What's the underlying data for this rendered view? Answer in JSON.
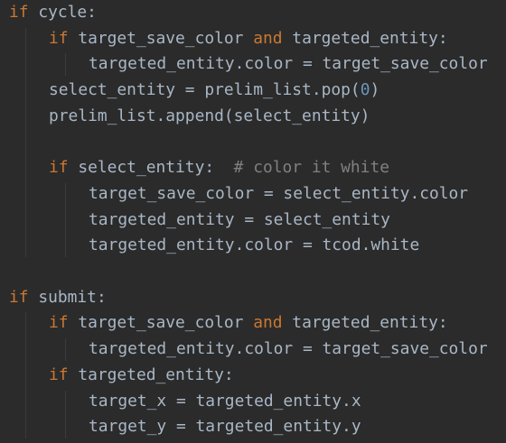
{
  "code_lines": [
    {
      "indent": 0,
      "tokens": [
        {
          "t": "kw",
          "v": "if"
        },
        {
          "t": "plain",
          "v": " cycle:"
        }
      ]
    },
    {
      "indent": 1,
      "tokens": [
        {
          "t": "kw",
          "v": "if"
        },
        {
          "t": "plain",
          "v": " target_save_color "
        },
        {
          "t": "kw",
          "v": "and"
        },
        {
          "t": "plain",
          "v": " targeted_entity:"
        }
      ]
    },
    {
      "indent": 2,
      "tokens": [
        {
          "t": "plain",
          "v": "targeted_entity.color = target_save_color"
        }
      ]
    },
    {
      "indent": 1,
      "tokens": [
        {
          "t": "plain",
          "v": "select_entity = prelim_list.pop("
        },
        {
          "t": "num",
          "v": "0"
        },
        {
          "t": "plain",
          "v": ")"
        }
      ]
    },
    {
      "indent": 1,
      "tokens": [
        {
          "t": "plain",
          "v": "prelim_list.append(select_entity)"
        }
      ]
    },
    {
      "indent": 0,
      "tokens": []
    },
    {
      "indent": 1,
      "tokens": [
        {
          "t": "kw",
          "v": "if"
        },
        {
          "t": "plain",
          "v": " select_entity:  "
        },
        {
          "t": "cmt",
          "v": "# color it white"
        }
      ]
    },
    {
      "indent": 2,
      "tokens": [
        {
          "t": "plain",
          "v": "target_save_color = select_entity.color"
        }
      ]
    },
    {
      "indent": 2,
      "tokens": [
        {
          "t": "plain",
          "v": "targeted_entity = select_entity"
        }
      ]
    },
    {
      "indent": 2,
      "tokens": [
        {
          "t": "plain",
          "v": "targeted_entity.color = tcod.white"
        }
      ]
    },
    {
      "indent": 0,
      "tokens": []
    },
    {
      "indent": 0,
      "tokens": [
        {
          "t": "kw",
          "v": "if"
        },
        {
          "t": "plain",
          "v": " submit:"
        }
      ]
    },
    {
      "indent": 1,
      "tokens": [
        {
          "t": "kw",
          "v": "if"
        },
        {
          "t": "plain",
          "v": " target_save_color "
        },
        {
          "t": "kw",
          "v": "and"
        },
        {
          "t": "plain",
          "v": " targeted_entity:"
        }
      ]
    },
    {
      "indent": 2,
      "tokens": [
        {
          "t": "plain",
          "v": "targeted_entity.color = target_save_color"
        }
      ]
    },
    {
      "indent": 1,
      "tokens": [
        {
          "t": "kw",
          "v": "if"
        },
        {
          "t": "plain",
          "v": " targeted_entity:"
        }
      ]
    },
    {
      "indent": 2,
      "tokens": [
        {
          "t": "plain",
          "v": "target_x = targeted_entity.x"
        }
      ]
    },
    {
      "indent": 2,
      "tokens": [
        {
          "t": "plain",
          "v": "target_y = targeted_entity.y"
        }
      ]
    }
  ],
  "colors": {
    "background": "#2b2b2b",
    "text": "#a9b7c6",
    "keyword": "#cc7832",
    "number": "#6897bb",
    "comment": "#808080",
    "indent_guide": "#3b3b3b"
  }
}
